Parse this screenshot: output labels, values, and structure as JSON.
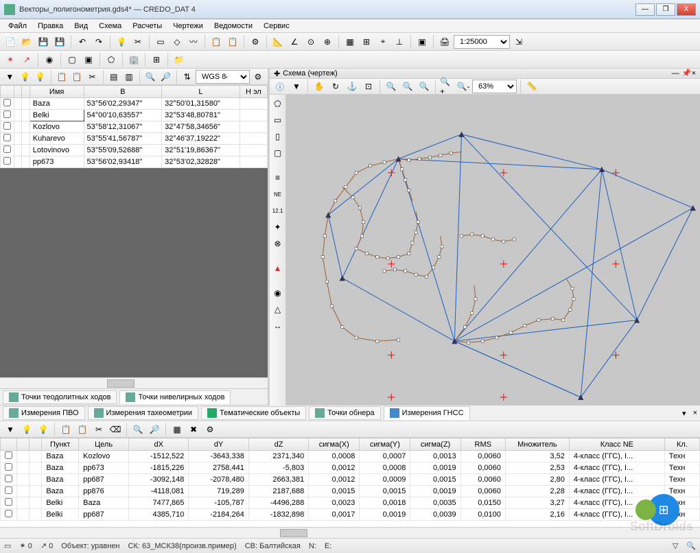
{
  "window": {
    "title": "Векторы_полигонометрия.gds4* — CREDO_DAT 4",
    "min": "—",
    "max": "❐",
    "close": "X"
  },
  "menus": [
    "Файл",
    "Правка",
    "Вид",
    "Схема",
    "Расчеты",
    "Чертежи",
    "Ведомости",
    "Сервис"
  ],
  "toolbar1": {
    "scale": "1:25000"
  },
  "left": {
    "coord_system": "WGS 84",
    "headers": [
      "",
      "",
      "",
      "Имя",
      "B",
      "L",
      "H эл"
    ],
    "rows": [
      {
        "name": "Baza",
        "b": "53°56'02,29347\"",
        "l": "32°50'01,31580\""
      },
      {
        "name": "Belki",
        "b": "54°00'10,63557\"",
        "l": "32°53'48,80781\""
      },
      {
        "name": "Kozlovo",
        "b": "53°58'12,31067\"",
        "l": "32°47'58,34656\""
      },
      {
        "name": "Kuharevo",
        "b": "53°55'41,56787\"",
        "l": "32°46'37,19222\""
      },
      {
        "name": "Lotovinovo",
        "b": "53°55'09,52688\"",
        "l": "32°51'19,86367\""
      },
      {
        "name": "pp673",
        "b": "53°56'02,93418\"",
        "l": "32°53'02,32828\""
      }
    ],
    "tab_theo": "Точки теодолитных ходов",
    "tab_level": "Точки нивелирных ходов"
  },
  "right": {
    "header": "Схема (чертеж)",
    "zoom": "63%"
  },
  "mid_tabs": [
    "Измерения ПВО",
    "Измерения тахеометрии",
    "Тематические объекты",
    "Точки обнера",
    "Измерения ГНСС"
  ],
  "gnss": {
    "headers": [
      "",
      "",
      "",
      "Пункт",
      "Цель",
      "dX",
      "dY",
      "dZ",
      "сигма(X)",
      "сигма(Y)",
      "сигма(Z)",
      "RMS",
      "Множитель",
      "Класс NE",
      "Кл."
    ],
    "rows": [
      {
        "p": "Baza",
        "t": "Kozlovo",
        "dx": "-1512,522",
        "dy": "-3643,338",
        "dz": "2371,340",
        "sx": "0,0008",
        "sy": "0,0007",
        "sz": "0,0013",
        "rms": "0,0060",
        "m": "3,52",
        "cne": "4-класс (ГГС), I...",
        "cl": "Техн"
      },
      {
        "p": "Baza",
        "t": "pp673",
        "dx": "-1815,226",
        "dy": "2758,441",
        "dz": "-5,803",
        "sx": "0,0012",
        "sy": "0,0008",
        "sz": "0,0019",
        "rms": "0,0060",
        "m": "2,53",
        "cne": "4-класс (ГГС), I...",
        "cl": "Техн"
      },
      {
        "p": "Baza",
        "t": "pp687",
        "dx": "-3092,148",
        "dy": "-2078,480",
        "dz": "2663,381",
        "sx": "0,0012",
        "sy": "0,0009",
        "sz": "0,0015",
        "rms": "0,0060",
        "m": "2,80",
        "cne": "4-класс (ГГС), I...",
        "cl": "Техн"
      },
      {
        "p": "Baza",
        "t": "pp876",
        "dx": "-4118,081",
        "dy": "719,289",
        "dz": "2187,688",
        "sx": "0,0015",
        "sy": "0,0015",
        "sz": "0,0019",
        "rms": "0,0060",
        "m": "2,28",
        "cne": "4-класс (ГГС), I...",
        "cl": "Техн"
      },
      {
        "p": "Belki",
        "t": "Baza",
        "dx": "7477,865",
        "dy": "-105,787",
        "dz": "-4496,288",
        "sx": "0,0023",
        "sy": "0,0018",
        "sz": "0,0035",
        "rms": "0,0150",
        "m": "3,27",
        "cne": "4-класс (ГГС), I...",
        "cl": "Техн"
      },
      {
        "p": "Belki",
        "t": "pp687",
        "dx": "4385,710",
        "dy": "-2184,264",
        "dz": "-1832,898",
        "sx": "0,0017",
        "sy": "0,0019",
        "sz": "0,0039",
        "rms": "0,0100",
        "m": "2,16",
        "cne": "4-класс (ГГС), I...",
        "cl": "Техн"
      }
    ]
  },
  "status": {
    "s0a": "0",
    "s0b": "0",
    "obj": "Объект: уравнен",
    "sk": "СК: 63_МСК38(произв.пример)",
    "sv": "СВ: Балтийская",
    "n": "N:",
    "e": "E:"
  },
  "watermark": "SoftDroids"
}
